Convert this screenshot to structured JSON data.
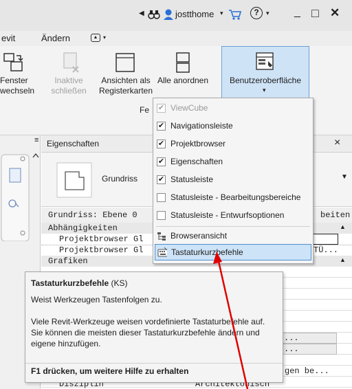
{
  "titlebar": {
    "user": "jostthome",
    "help_symbol": "?",
    "window_minimize": "_",
    "window_maximize": "□",
    "window_close": "✕"
  },
  "menubar": {
    "items": [
      "evit",
      "Ändern"
    ]
  },
  "ribbon": {
    "tools": [
      {
        "label1": "Fenster",
        "label2": "wechseln",
        "disabled": false
      },
      {
        "label1": "Inaktive",
        "label2": "schließen",
        "disabled": true
      },
      {
        "label1": "Ansichten als",
        "label2": "Registerkarten",
        "disabled": false
      },
      {
        "label1": "Alle anordnen",
        "label2": "",
        "disabled": false
      },
      {
        "label1": "Benutzeroberfläche",
        "label2": "",
        "disabled": false
      }
    ],
    "panel_label_fragment": "Fe"
  },
  "dropdown": {
    "items": [
      {
        "label": "ViewCube",
        "checked": true,
        "disabled": true
      },
      {
        "label": "Navigationsleiste",
        "checked": true,
        "disabled": false
      },
      {
        "label": "Projektbrowser",
        "checked": true,
        "disabled": false
      },
      {
        "label": "Eigenschaften",
        "checked": true,
        "disabled": false
      },
      {
        "label": "Statusleiste",
        "checked": true,
        "disabled": false
      },
      {
        "label": "Statusleiste - Bearbeitungsbereiche",
        "checked": false,
        "disabled": false
      },
      {
        "label": "Statusleiste - Entwurfsoptionen",
        "checked": false,
        "disabled": false
      },
      {
        "label": "Browseransicht",
        "icon": "browser-tree-icon"
      },
      {
        "label": "Tastaturkurzbefehle",
        "icon": "keyboard-icon",
        "highlighted": true
      }
    ]
  },
  "properties": {
    "title": "Eigenschaften",
    "close": "×",
    "type_name": "Grundriss",
    "instance_label": "Grundriss: Ebene 0",
    "edit_fragment": "beiten",
    "group_constraints": "Abhängigkeiten",
    "row1_label": "Projektbrowser Gl",
    "row2_label": "Projektbrowser Gl",
    "row2_value": "TÜ...",
    "group_graphics": "Grafiken",
    "row_ellipsis_1": "...",
    "row_ellipsis_2": "...",
    "row_value_be": "gen be...",
    "row_bottom_label": "Disziplin",
    "row_bottom_value": "Architektonisch"
  },
  "tooltip": {
    "title": "Tastaturkurzbefehle",
    "title_suffix": " (KS)",
    "line1": "Weist Werkzeugen Tastenfolgen zu.",
    "paragraph": "Viele Revit-Werkzeuge weisen vordefinierte Tastaturbefehle auf. Sie können die meisten dieser Tastaturkurzbefehle ändern und eigene hinzufügen.",
    "footer": "F1 drücken, um weitere Hilfe zu erhalten"
  },
  "colors": {
    "highlight": "#cde3f7",
    "highlight_border": "#4e8fd0",
    "arrow": "#e00000"
  }
}
